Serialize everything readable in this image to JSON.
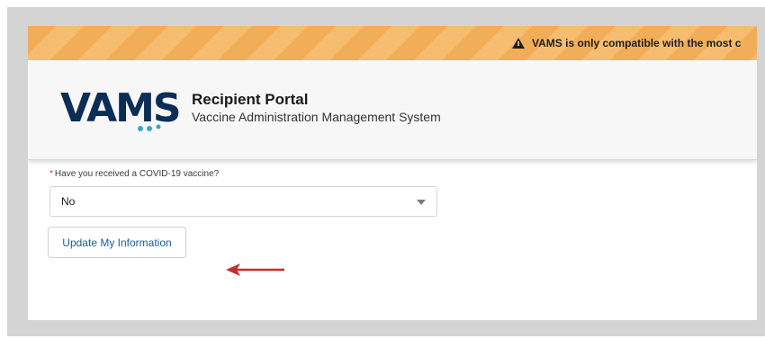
{
  "banner": {
    "icon": "warning-icon",
    "text": "VAMS is only compatible with the most c",
    "colors": {
      "stripe_a": "#f2ad58",
      "stripe_b": "#f6bd70"
    }
  },
  "header": {
    "logo_text": "VAMS",
    "logo_color": "#0c2d55",
    "title": "Recipient Portal",
    "subtitle": "Vaccine Administration Management System"
  },
  "form": {
    "required_marker": "*",
    "question_label": "Have you received a COVID-19 vaccine?",
    "select_value": "No",
    "select_icon": "chevron-down-icon"
  },
  "actions": {
    "update_label": "Update My Information",
    "annotation_arrow_color": "#c0312f"
  }
}
